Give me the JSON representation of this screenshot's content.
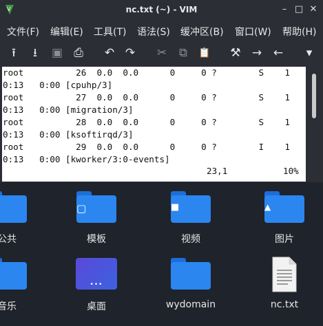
{
  "window": {
    "title": "nc.txt (~) - VIM",
    "min_glyph": "–",
    "max_glyph": "□",
    "close_glyph": "✕"
  },
  "menu": [
    "文件(F)",
    "编辑(E)",
    "工具(T)",
    "语法(S)",
    "缓冲区(B)",
    "窗口(W)",
    "帮助(H)"
  ],
  "toolbar": [
    {
      "icon": "upload-icon",
      "glyph": "⭱"
    },
    {
      "icon": "download-icon",
      "glyph": "⭳"
    },
    {
      "icon": "save-icon",
      "glyph": "▣"
    },
    {
      "icon": "print-icon",
      "glyph": "⎙"
    },
    {
      "icon": "undo-icon",
      "glyph": "↶"
    },
    {
      "icon": "redo-icon",
      "glyph": "↷"
    },
    {
      "icon": "cut-icon",
      "glyph": "✂"
    },
    {
      "icon": "copy-icon",
      "glyph": "⧉"
    },
    {
      "icon": "paste-icon",
      "glyph": "📋"
    },
    {
      "icon": "tools-icon",
      "glyph": "⚒"
    },
    {
      "icon": "forward-icon",
      "glyph": "→"
    },
    {
      "icon": "back-icon",
      "glyph": "←"
    },
    {
      "icon": "dropdown-icon",
      "glyph": "▾"
    }
  ],
  "lines": [
    "root          26  0.0  0.0      0     0 ?        S    1",
    "0:13   0:00 [cpuhp/3]",
    "root          27  0.0  0.0      0     0 ?        S    1",
    "0:13   0:00 [migration/3]",
    "root          28  0.0  0.0      0     0 ?        S    1",
    "0:13   0:00 [ksoftirqd/3]",
    "root          29  0.0  0.0      0     0 ?        I    1",
    "0:13   0:00 [kworker/3:0-events]"
  ],
  "status": {
    "position": "23,1",
    "percent": "10%"
  },
  "desktop": [
    {
      "label": "公共",
      "icon": "people-folder-icon",
      "glyph": "👥"
    },
    {
      "label": "模板",
      "icon": "template-folder-icon",
      "glyph": "▢"
    },
    {
      "label": "视频",
      "icon": "video-folder-icon",
      "glyph": "■"
    },
    {
      "label": "图片",
      "icon": "pictures-folder-icon",
      "glyph": "▲"
    },
    {
      "label": "音乐",
      "icon": "music-folder-icon",
      "glyph": "♫"
    },
    {
      "label": "桌面",
      "icon": "desktop-folder-icon",
      "glyph": "•••"
    },
    {
      "label": "wydomain",
      "icon": "folder-icon",
      "glyph": ""
    },
    {
      "label": "nc.txt",
      "icon": "text-file-icon",
      "glyph": ""
    }
  ]
}
